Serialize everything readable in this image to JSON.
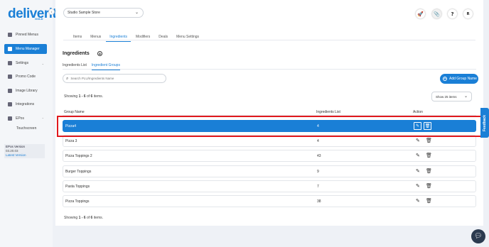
{
  "brand": {
    "logo": "deliverit",
    "logo_sub": "GOLD"
  },
  "sidebar": {
    "items": [
      {
        "label": "Pinned Menus",
        "icon": "pin-icon"
      },
      {
        "label": "Menu Manager",
        "icon": "menu-icon",
        "active": true
      },
      {
        "label": "Settings",
        "icon": "gear-icon"
      },
      {
        "label": "Promo Code",
        "icon": "ticket-icon"
      },
      {
        "label": "Image Library",
        "icon": "image-icon"
      },
      {
        "label": "Integrations",
        "icon": "plug-icon"
      },
      {
        "label": "EPos",
        "icon": "pos-icon"
      }
    ],
    "sub_items": [
      {
        "label": "Touchscreen"
      }
    ],
    "version": {
      "title": "EPos Version",
      "number": "03.20.03",
      "link": "Latest Version"
    }
  },
  "header": {
    "store": "Studio Sample Store",
    "avatar_initial": "R",
    "help_label": "?"
  },
  "tabs": [
    {
      "label": "Items"
    },
    {
      "label": "Menus"
    },
    {
      "label": "Ingredients",
      "active": true
    },
    {
      "label": "Modifiers"
    },
    {
      "label": "Deals"
    },
    {
      "label": "Menu Settings"
    }
  ],
  "section": {
    "title": "Ingredients"
  },
  "subtabs": [
    {
      "label": "Ingredients List"
    },
    {
      "label": "Ingredient Groups",
      "active": true
    }
  ],
  "search": {
    "placeholder": "Search PLU/Ingredients Name"
  },
  "add_button": {
    "label": "Add Group Name"
  },
  "pagination": {
    "prefix": "Showing ",
    "range": "1 - 6",
    "middle": " of ",
    "total": "6",
    "suffix": " items."
  },
  "page_size": {
    "label": "Show 25 items"
  },
  "table": {
    "headers": {
      "name": "Group Name",
      "list": "Ingredients List",
      "action": "Action"
    },
    "rows": [
      {
        "name": "Pizza4",
        "count": "4",
        "selected": true
      },
      {
        "name": "Pizza 3",
        "count": "4"
      },
      {
        "name": "Pizza Toppings 2",
        "count": "43"
      },
      {
        "name": "Burger Toppings",
        "count": "9"
      },
      {
        "name": "Pasta Toppings",
        "count": "7"
      },
      {
        "name": "Pizza Toppings",
        "count": "38"
      }
    ]
  },
  "feedback": {
    "label": "Feedback"
  },
  "colors": {
    "accent": "#1a7fd6",
    "highlight": "#e0191e",
    "chat": "#2b3a4f"
  }
}
